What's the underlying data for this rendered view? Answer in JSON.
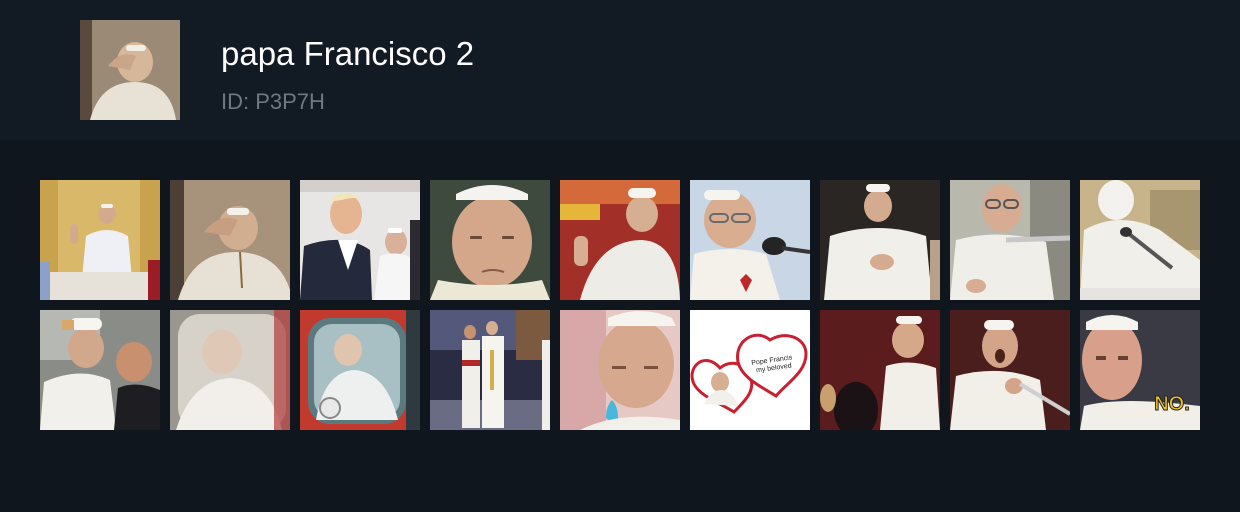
{
  "pack": {
    "title": "papa Francisco 2",
    "id_label": "ID: P3P7H"
  },
  "stickers": [
    {
      "name": "pope-waving-balcony"
    },
    {
      "name": "pope-hand-on-forehead"
    },
    {
      "name": "man-in-suit-with-pope"
    },
    {
      "name": "pope-closeup-frown"
    },
    {
      "name": "pope-raising-hand"
    },
    {
      "name": "pope-glasses-microphone"
    },
    {
      "name": "pope-clasped-hands"
    },
    {
      "name": "pope-at-microphone"
    },
    {
      "name": "pope-blurred-microphone"
    },
    {
      "name": "pope-kissing-child"
    },
    {
      "name": "pope-behind-glass"
    },
    {
      "name": "pope-in-popemobile"
    },
    {
      "name": "pope-with-clergy-stage"
    },
    {
      "name": "pope-crying-tear"
    },
    {
      "name": "pope-heart-beloved",
      "caption": "Pope Francis my beloved"
    },
    {
      "name": "pope-smiling-crowd"
    },
    {
      "name": "pope-shocked-pointing"
    },
    {
      "name": "pope-no",
      "caption": "NO."
    }
  ]
}
